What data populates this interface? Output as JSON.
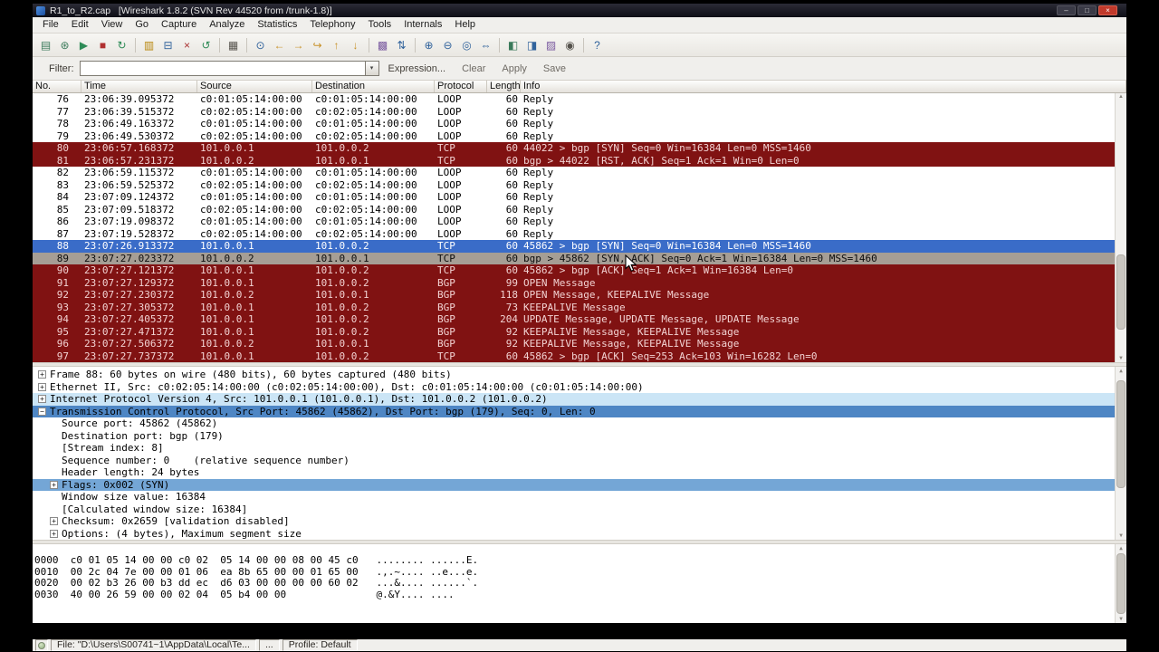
{
  "window": {
    "title": "R1_to_R2.cap   [Wireshark 1.8.2 (SVN Rev 44520 from /trunk-1.8)]",
    "minimize": "–",
    "maximize": "□",
    "close": "×"
  },
  "menu": {
    "items": [
      "File",
      "Edit",
      "View",
      "Go",
      "Capture",
      "Analyze",
      "Statistics",
      "Telephony",
      "Tools",
      "Internals",
      "Help"
    ]
  },
  "toolbar": {
    "groups": [
      [
        {
          "name": "list-interfaces-icon",
          "glyph": "▤",
          "color": "#3a7a5a"
        },
        {
          "name": "capture-options-icon",
          "glyph": "⊛",
          "color": "#3a7a5a"
        },
        {
          "name": "start-capture-icon",
          "glyph": "▶",
          "color": "#2e8b57"
        },
        {
          "name": "stop-capture-icon",
          "glyph": "■",
          "color": "#b03030"
        },
        {
          "name": "restart-capture-icon",
          "glyph": "↻",
          "color": "#2e8b57"
        }
      ],
      [
        {
          "name": "open-file-icon",
          "glyph": "▥",
          "color": "#b8860b"
        },
        {
          "name": "save-file-icon",
          "glyph": "⊟",
          "color": "#31639c"
        },
        {
          "name": "close-file-icon",
          "glyph": "×",
          "color": "#aa3333"
        },
        {
          "name": "reload-file-icon",
          "glyph": "↺",
          "color": "#2e8b57"
        }
      ],
      [
        {
          "name": "print-icon",
          "glyph": "▦",
          "color": "#55524c"
        }
      ],
      [
        {
          "name": "find-packet-icon",
          "glyph": "⊙",
          "color": "#31639c"
        },
        {
          "name": "go-back-icon",
          "glyph": "←",
          "color": "#c8922a"
        },
        {
          "name": "go-forward-icon",
          "glyph": "→",
          "color": "#c8922a"
        },
        {
          "name": "goto-packet-icon",
          "glyph": "↪",
          "color": "#c8922a"
        },
        {
          "name": "goto-top-icon",
          "glyph": "↑",
          "color": "#c8922a"
        },
        {
          "name": "goto-bottom-icon",
          "glyph": "↓",
          "color": "#c8922a"
        }
      ],
      [
        {
          "name": "colorize-toggle-icon",
          "glyph": "▩",
          "color": "#7a5aa0"
        },
        {
          "name": "autoscroll-toggle-icon",
          "glyph": "⇅",
          "color": "#31639c"
        }
      ],
      [
        {
          "name": "zoom-in-icon",
          "glyph": "⊕",
          "color": "#31639c"
        },
        {
          "name": "zoom-out-icon",
          "glyph": "⊖",
          "color": "#31639c"
        },
        {
          "name": "zoom-100-icon",
          "glyph": "◎",
          "color": "#31639c"
        },
        {
          "name": "resize-columns-icon",
          "glyph": "⇔",
          "color": "#31639c"
        }
      ],
      [
        {
          "name": "capture-filters-icon",
          "glyph": "◧",
          "color": "#3a7a5a"
        },
        {
          "name": "display-filters-icon",
          "glyph": "◨",
          "color": "#31639c"
        },
        {
          "name": "coloring-rules-icon",
          "glyph": "▨",
          "color": "#7a5aa0"
        },
        {
          "name": "preferences-icon",
          "glyph": "◉",
          "color": "#55524c"
        }
      ],
      [
        {
          "name": "help-icon",
          "glyph": "?",
          "color": "#31639c"
        }
      ]
    ]
  },
  "filter": {
    "label": "Filter:",
    "value": "",
    "dropdown_glyph": "▾",
    "buttons": [
      "Expression...",
      "Clear",
      "Apply",
      "Save"
    ]
  },
  "scrollbar": {
    "up": "▲",
    "down": "▼"
  },
  "packet_list": {
    "columns": [
      "No.",
      "Time",
      "Source",
      "Destination",
      "Protocol",
      "Length",
      "Info"
    ],
    "rows": [
      {
        "no": "76",
        "time": "23:06:39.095372",
        "src": "c0:01:05:14:00:00",
        "dst": "c0:01:05:14:00:00",
        "proto": "LOOP",
        "len": "60",
        "info": "Reply",
        "style": "normal"
      },
      {
        "no": "77",
        "time": "23:06:39.515372",
        "src": "c0:02:05:14:00:00",
        "dst": "c0:02:05:14:00:00",
        "proto": "LOOP",
        "len": "60",
        "info": "Reply",
        "style": "normal"
      },
      {
        "no": "78",
        "time": "23:06:49.163372",
        "src": "c0:01:05:14:00:00",
        "dst": "c0:01:05:14:00:00",
        "proto": "LOOP",
        "len": "60",
        "info": "Reply",
        "style": "normal"
      },
      {
        "no": "79",
        "time": "23:06:49.530372",
        "src": "c0:02:05:14:00:00",
        "dst": "c0:02:05:14:00:00",
        "proto": "LOOP",
        "len": "60",
        "info": "Reply",
        "style": "normal"
      },
      {
        "no": "80",
        "time": "23:06:57.168372",
        "src": "101.0.0.1",
        "dst": "101.0.0.2",
        "proto": "TCP",
        "len": "60",
        "info": "44022 > bgp [SYN] Seq=0 Win=16384 Len=0 MSS=1460",
        "style": "red"
      },
      {
        "no": "81",
        "time": "23:06:57.231372",
        "src": "101.0.0.2",
        "dst": "101.0.0.1",
        "proto": "TCP",
        "len": "60",
        "info": "bgp > 44022 [RST, ACK] Seq=1 Ack=1 Win=0 Len=0",
        "style": "red"
      },
      {
        "no": "82",
        "time": "23:06:59.115372",
        "src": "c0:01:05:14:00:00",
        "dst": "c0:01:05:14:00:00",
        "proto": "LOOP",
        "len": "60",
        "info": "Reply",
        "style": "normal"
      },
      {
        "no": "83",
        "time": "23:06:59.525372",
        "src": "c0:02:05:14:00:00",
        "dst": "c0:02:05:14:00:00",
        "proto": "LOOP",
        "len": "60",
        "info": "Reply",
        "style": "normal"
      },
      {
        "no": "84",
        "time": "23:07:09.124372",
        "src": "c0:01:05:14:00:00",
        "dst": "c0:01:05:14:00:00",
        "proto": "LOOP",
        "len": "60",
        "info": "Reply",
        "style": "normal"
      },
      {
        "no": "85",
        "time": "23:07:09.518372",
        "src": "c0:02:05:14:00:00",
        "dst": "c0:02:05:14:00:00",
        "proto": "LOOP",
        "len": "60",
        "info": "Reply",
        "style": "normal"
      },
      {
        "no": "86",
        "time": "23:07:19.098372",
        "src": "c0:01:05:14:00:00",
        "dst": "c0:01:05:14:00:00",
        "proto": "LOOP",
        "len": "60",
        "info": "Reply",
        "style": "normal"
      },
      {
        "no": "87",
        "time": "23:07:19.528372",
        "src": "c0:02:05:14:00:00",
        "dst": "c0:02:05:14:00:00",
        "proto": "LOOP",
        "len": "60",
        "info": "Reply",
        "style": "normal"
      },
      {
        "no": "88",
        "time": "23:07:26.913372",
        "src": "101.0.0.1",
        "dst": "101.0.0.2",
        "proto": "TCP",
        "len": "60",
        "info": "45862 > bgp [SYN] Seq=0 Win=16384 Len=0 MSS=1460",
        "style": "sel"
      },
      {
        "no": "89",
        "time": "23:07:27.023372",
        "src": "101.0.0.2",
        "dst": "101.0.0.1",
        "proto": "TCP",
        "len": "60",
        "info": "bgp > 45862 [SYN, ACK] Seq=0 Ack=1 Win=16384 Len=0 MSS=1460",
        "style": "hov"
      },
      {
        "no": "90",
        "time": "23:07:27.121372",
        "src": "101.0.0.1",
        "dst": "101.0.0.2",
        "proto": "TCP",
        "len": "60",
        "info": "45862 > bgp [ACK] Seq=1 Ack=1 Win=16384 Len=0",
        "style": "red"
      },
      {
        "no": "91",
        "time": "23:07:27.129372",
        "src": "101.0.0.1",
        "dst": "101.0.0.2",
        "proto": "BGP",
        "len": "99",
        "info": "OPEN Message",
        "style": "red"
      },
      {
        "no": "92",
        "time": "23:07:27.230372",
        "src": "101.0.0.2",
        "dst": "101.0.0.1",
        "proto": "BGP",
        "len": "118",
        "info": "OPEN Message, KEEPALIVE Message",
        "style": "red"
      },
      {
        "no": "93",
        "time": "23:07:27.305372",
        "src": "101.0.0.1",
        "dst": "101.0.0.2",
        "proto": "BGP",
        "len": "73",
        "info": "KEEPALIVE Message",
        "style": "red"
      },
      {
        "no": "94",
        "time": "23:07:27.405372",
        "src": "101.0.0.1",
        "dst": "101.0.0.2",
        "proto": "BGP",
        "len": "204",
        "info": "UPDATE Message, UPDATE Message, UPDATE Message",
        "style": "red"
      },
      {
        "no": "95",
        "time": "23:07:27.471372",
        "src": "101.0.0.1",
        "dst": "101.0.0.2",
        "proto": "BGP",
        "len": "92",
        "info": "KEEPALIVE Message, KEEPALIVE Message",
        "style": "red"
      },
      {
        "no": "96",
        "time": "23:07:27.506372",
        "src": "101.0.0.2",
        "dst": "101.0.0.1",
        "proto": "BGP",
        "len": "92",
        "info": "KEEPALIVE Message, KEEPALIVE Message",
        "style": "red"
      },
      {
        "no": "97",
        "time": "23:07:27.737372",
        "src": "101.0.0.1",
        "dst": "101.0.0.2",
        "proto": "TCP",
        "len": "60",
        "info": "45862 > bgp [ACK] Seq=253 Ack=103 Win=16282 Len=0",
        "style": "red"
      }
    ]
  },
  "details": {
    "lines": [
      {
        "exp": "+",
        "indent": 0,
        "style": "normal",
        "text": "Frame 88: 60 bytes on wire (480 bits), 60 bytes captured (480 bits)"
      },
      {
        "exp": "+",
        "indent": 0,
        "style": "normal",
        "text": "Ethernet II, Src: c0:02:05:14:00:00 (c0:02:05:14:00:00), Dst: c0:01:05:14:00:00 (c0:01:05:14:00:00)"
      },
      {
        "exp": "+",
        "indent": 0,
        "style": "ipv4",
        "text": "Internet Protocol Version 4, Src: 101.0.0.1 (101.0.0.1), Dst: 101.0.0.2 (101.0.0.2)"
      },
      {
        "exp": "-",
        "indent": 0,
        "style": "selected",
        "text": "Transmission Control Protocol, Src Port: 45862 (45862), Dst Port: bgp (179), Seq: 0, Len: 0"
      },
      {
        "exp": "",
        "indent": 1,
        "style": "normal",
        "text": "Source port: 45862 (45862)"
      },
      {
        "exp": "",
        "indent": 1,
        "style": "normal",
        "text": "Destination port: bgp (179)"
      },
      {
        "exp": "",
        "indent": 1,
        "style": "normal",
        "text": "[Stream index: 8]"
      },
      {
        "exp": "",
        "indent": 1,
        "style": "normal",
        "text": "Sequence number: 0    (relative sequence number)"
      },
      {
        "exp": "",
        "indent": 1,
        "style": "normal",
        "text": "Header length: 24 bytes"
      },
      {
        "exp": "+",
        "indent": 1,
        "style": "flags",
        "text": "Flags: 0x002 (SYN)"
      },
      {
        "exp": "",
        "indent": 1,
        "style": "normal",
        "text": "Window size value: 16384"
      },
      {
        "exp": "",
        "indent": 1,
        "style": "normal",
        "text": "[Calculated window size: 16384]"
      },
      {
        "exp": "+",
        "indent": 1,
        "style": "normal",
        "text": "Checksum: 0x2659 [validation disabled]"
      },
      {
        "exp": "+",
        "indent": 1,
        "style": "normal",
        "text": "Options: (4 bytes), Maximum segment size"
      }
    ]
  },
  "hex": {
    "lines": [
      "0000  c0 01 05 14 00 00 c0 02  05 14 00 00 08 00 45 c0   ........ ......E.",
      "0010  00 2c 04 7e 00 00 01 06  ea 8b 65 00 00 01 65 00   .,.~.... ..e...e.",
      "0020  00 02 b3 26 00 b3 dd ec  d6 03 00 00 00 00 60 02   ...&.... ......`.",
      "0030  40 00 26 59 00 00 02 04  05 b4 00 00               @.&Y.... ...."
    ]
  },
  "status": {
    "file": "File: \"D:\\Users\\S00741~1\\AppData\\Local\\Te...",
    "counts": "...",
    "profile": "Profile: Default"
  },
  "colors": {
    "row_red": "#801212",
    "row_selected": "#3a6cc8",
    "row_hover": "#a69e95",
    "detail_selected": "#4e86c4",
    "detail_flags": "#74a6d6",
    "detail_ipv4": "#cbe5f6"
  }
}
